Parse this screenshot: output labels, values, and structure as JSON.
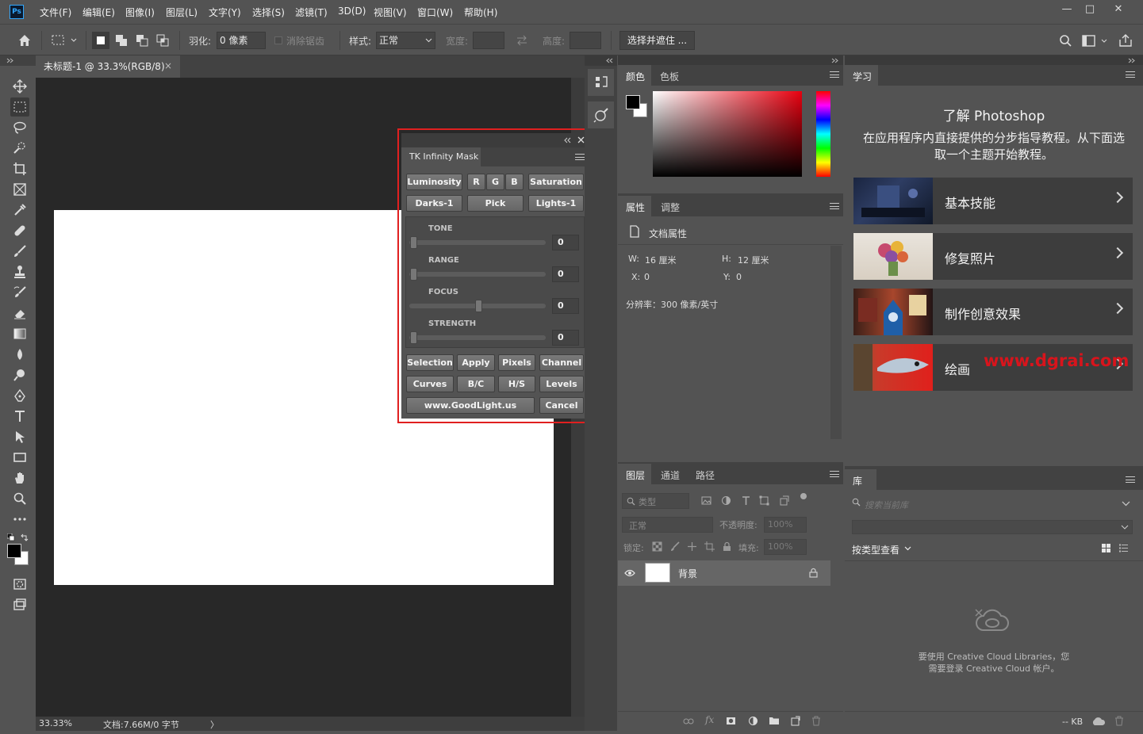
{
  "menubar": {
    "app_icon": "Ps",
    "items": [
      "文件(F)",
      "编辑(E)",
      "图像(I)",
      "图层(L)",
      "文字(Y)",
      "选择(S)",
      "滤镜(T)",
      "3D(D)",
      "视图(V)",
      "窗口(W)",
      "帮助(H)"
    ],
    "window_controls": {
      "minimize": "—",
      "maximize": "□",
      "close": "✕"
    }
  },
  "options": {
    "feather_label": "羽化:",
    "feather_value": "0 像素",
    "antialias_label": "消除锯齿",
    "style_label": "样式:",
    "style_value": "正常",
    "width_label": "宽度:",
    "height_label": "高度:",
    "select_mask_button": "选择并遮住 ..."
  },
  "document": {
    "tab_title": "未标题-1 @ 33.3%(RGB/8)",
    "tab_close": "×",
    "zoom": "33.33%",
    "doc_info": "文档:7.66M/0 字节",
    "status_arrow": "〉"
  },
  "tk_panel": {
    "title": "TK Infinity Mask",
    "row1": [
      "Luminosity",
      "R",
      "G",
      "B",
      "Saturation"
    ],
    "row2": [
      "Darks-1",
      "Pick",
      "Lights-1"
    ],
    "sliders": [
      {
        "label": "TONE",
        "value": "0",
        "fraction": 0.0
      },
      {
        "label": "RANGE",
        "value": "0",
        "fraction": 0.0
      },
      {
        "label": "FOCUS",
        "value": "0",
        "fraction": 0.5
      },
      {
        "label": "STRENGTH",
        "value": "0",
        "fraction": 0.0
      }
    ],
    "row3": [
      "Selection",
      "Apply",
      "Pixels",
      "Channel"
    ],
    "row4": [
      "Curves",
      "B/C",
      "H/S",
      "Levels"
    ],
    "website": "www.GoodLight.us",
    "cancel": "Cancel"
  },
  "color_panel": {
    "tabs": [
      "颜色",
      "色板"
    ]
  },
  "properties_panel": {
    "tabs": [
      "属性",
      "调整"
    ],
    "section_title": "文档属性",
    "w_label": "W:",
    "w_value": "16 厘米",
    "h_label": "H:",
    "h_value": "12 厘米",
    "x_label": "X:",
    "x_value": "0",
    "y_label": "Y:",
    "y_value": "0",
    "resolution": "分辨率：300 像素/英寸"
  },
  "layers_panel": {
    "tabs": [
      "图层",
      "通道",
      "路径"
    ],
    "filter_placeholder": "类型",
    "blend_mode": "正常",
    "opacity_label": "不透明度:",
    "opacity_value": "100%",
    "lock_label": "锁定:",
    "fill_label": "填充:",
    "fill_value": "100%",
    "layers": [
      {
        "name": "背景",
        "visible": true,
        "locked": true
      }
    ]
  },
  "learn_panel": {
    "tab": "学习",
    "title": "了解 Photoshop",
    "description": "在应用程序内直接提供的分步指导教程。从下面选取一个主题开始教程。",
    "cards": [
      "基本技能",
      "修复照片",
      "制作创意效果",
      "绘画"
    ],
    "watermark": "www.dgrai.com"
  },
  "library_panel": {
    "tab": "库",
    "search_placeholder": "搜索当前库",
    "view_by": "按类型查看",
    "message_line1": "要使用 Creative Cloud Libraries，您",
    "message_line2": "需要登录 Creative Cloud 帐户。",
    "size": "-- KB"
  },
  "colors": {
    "bg": "#535353",
    "canvas_area": "#282828",
    "highlight_red": "#e02020"
  }
}
